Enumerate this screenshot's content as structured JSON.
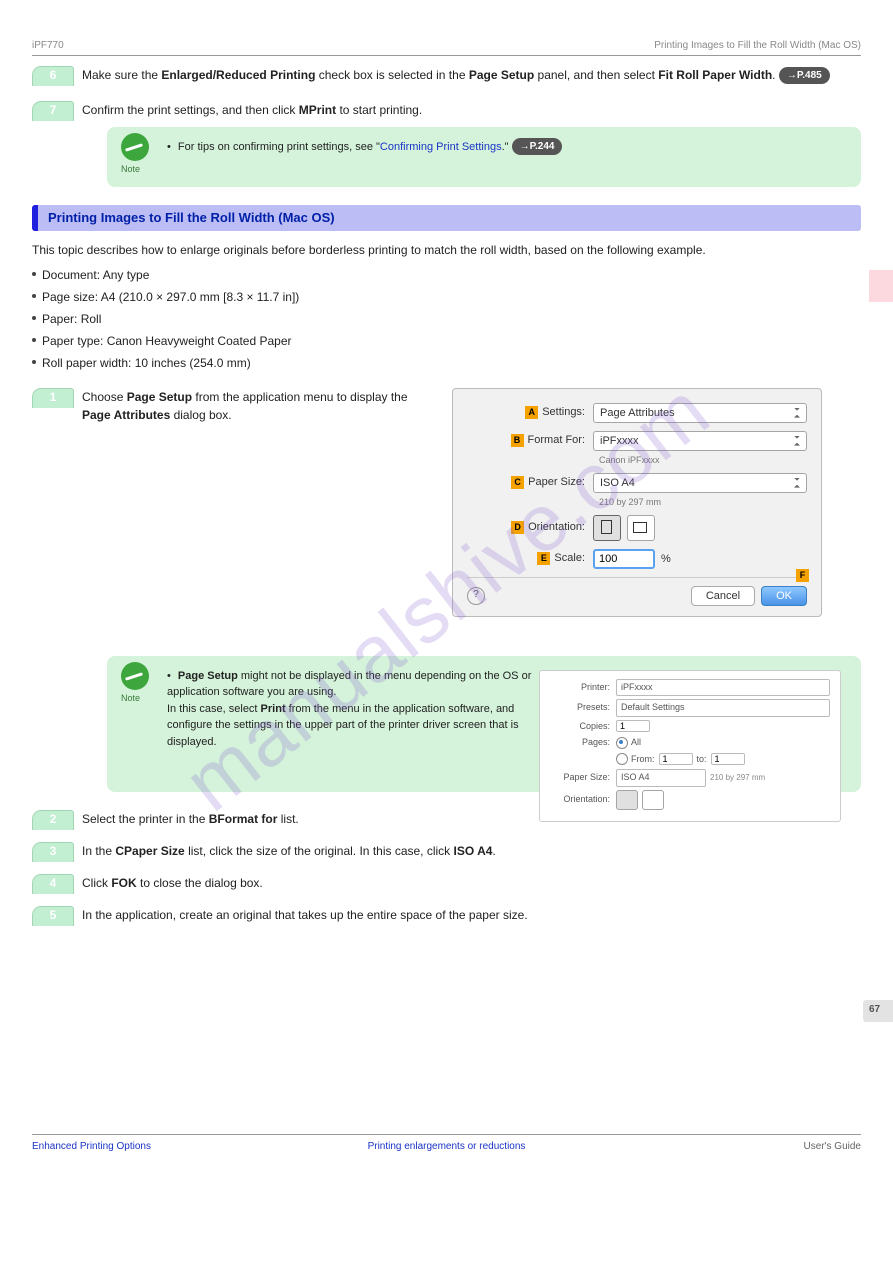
{
  "header": {
    "left": "iPF770",
    "right": "Printing Images to Fill the Roll Width (Mac OS)"
  },
  "watermark": "manualshive.com",
  "step6": {
    "num": "6",
    "line1_a": "Make sure the ",
    "line1_b": "Enlarged/Reduced Printing",
    "line1_c": " check box is selected in the ",
    "line1_d": "Page Setup",
    "line1_e": " panel, and then select ",
    "line1_f": "Fit Roll Paper Width",
    "line1_g": ".",
    "ref_lbl": "→P.485"
  },
  "step7": {
    "num": "7",
    "text_a": "Confirm the print settings, and then click ",
    "text_b": "MPrint",
    "text_c": " to start printing.",
    "note": "Note",
    "note_a": "For tips on confirming print settings, see \"",
    "note_link": "Confirming Print Settings",
    "note_b": ".\"",
    "note_ref": "→P.244"
  },
  "section": "Printing Images to Fill the Roll Width (Mac OS)",
  "desc_a": "This topic describes how to enlarge originals before borderless printing to match the roll width, based on the following example.",
  "bullets": {
    "doc": "Document: Any type",
    "page": "Page size: A4 (210.0 × 297.0 mm [8.3 × 11.7 in])",
    "paper": "Paper: Roll",
    "type": "Paper type: Canon Heavyweight Coated Paper",
    "width": "Roll paper width: 10 inches (254.0 mm)"
  },
  "step1": {
    "num": "1",
    "text_a": "Choose ",
    "text_b": "Page Setup",
    "text_c": " from the application menu to display the ",
    "text_d": "Page Attributes",
    "text_e": " dialog box.",
    "dialog": {
      "A": "A",
      "B": "B",
      "C": "C",
      "D": "D",
      "E": "E",
      "F": "F",
      "settings_lbl": "Settings:",
      "settings_val": "Page Attributes",
      "format_lbl": "Format For:",
      "format_val": "iPFxxxx",
      "format_sub": "Canon iPFxxxx",
      "size_lbl": "Paper Size:",
      "size_val": "ISO A4",
      "size_sub": "210 by 297 mm",
      "orient_lbl": "Orientation:",
      "scale_lbl": "Scale:",
      "scale_val": "100",
      "scale_pct": "%",
      "help": "?",
      "cancel": "Cancel",
      "ok": "OK"
    },
    "note": "Note",
    "note_text_a": "Page Setup",
    "note_text_b": " might not be displayed in the menu depending on the OS or application software you are using.",
    "note_text_c": "In this case, select ",
    "note_text_d": "Print",
    "note_text_e": " from the menu in the application software, and configure the settings in the upper part of the printer driver screen that is displayed.",
    "mini": {
      "printer_lbl": "Printer:",
      "printer_val": "iPFxxxx",
      "presets_lbl": "Presets:",
      "presets_val": "Default Settings",
      "copies_lbl": "Copies:",
      "copies_val": "1",
      "pages_lbl": "Pages:",
      "all": "All",
      "from": "From:",
      "from_v": "1",
      "to": "to:",
      "to_v": "1",
      "psize_lbl": "Paper Size:",
      "psize_val": "ISO A4",
      "psize_dim": "210 by 297 mm",
      "orient_lbl": "Orientation:"
    }
  },
  "step2": {
    "num": "2",
    "a": "Select the printer in the ",
    "b": "BFormat for",
    "c": " list."
  },
  "step3": {
    "num": "3",
    "a": "In the ",
    "b": "CPaper Size",
    "c": " list, click the size of the original. In this case, click ",
    "d": "ISO A4",
    "e": "."
  },
  "step4": {
    "num": "4",
    "a": "Click ",
    "b": "FOK",
    "c": " to close the dialog box."
  },
  "step5": {
    "num": "5",
    "a": "In the application, create an original that takes up the entire space of the paper size."
  },
  "sidebar": "67",
  "footer": {
    "left": "Enhanced Printing Options",
    "center": "Printing enlargements or reductions",
    "right": "User's Guide"
  }
}
